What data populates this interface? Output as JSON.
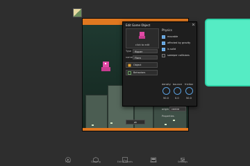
{
  "dialog": {
    "title": "Edit Game Object",
    "sprite_caption": "click to edit",
    "fields": [
      {
        "label": "Type",
        "value": "flipper"
      },
      {
        "label": "name",
        "value": "Flora"
      }
    ],
    "buttons": [
      {
        "label": "Object",
        "icon": "object-icon"
      },
      {
        "label": "Behaviors",
        "icon": "behaviors-icon"
      }
    ],
    "physics_title": "Physics",
    "checkboxes": [
      {
        "label": "movable",
        "checked": true
      },
      {
        "label": "affected by gravity",
        "checked": true
      },
      {
        "label": "is solid",
        "checked": true
      },
      {
        "label": "sweeper collisions",
        "checked": false
      }
    ],
    "sliders": [
      {
        "label": "density",
        "value": "50.0"
      },
      {
        "label": "bounce",
        "value": "0.0"
      },
      {
        "label": "friction",
        "value": "50.0"
      }
    ],
    "origin_label": "origin",
    "origin_value": "centre",
    "properties_label": "Properties",
    "ok_label": "ok"
  },
  "toolbar": [
    {
      "label": "Play",
      "icon": "play-icon"
    },
    {
      "label": "Gaming",
      "icon": "cube-icon"
    },
    {
      "label": "Edit a Levels",
      "icon": "image-icon"
    },
    {
      "label": "Level",
      "icon": "level-icon"
    },
    {
      "label": "Settings",
      "icon": "sliders-icon"
    }
  ],
  "colors": {
    "accent": "#5aa0e0",
    "panel": "#55ecc4",
    "stage_bar": "#e07820"
  }
}
